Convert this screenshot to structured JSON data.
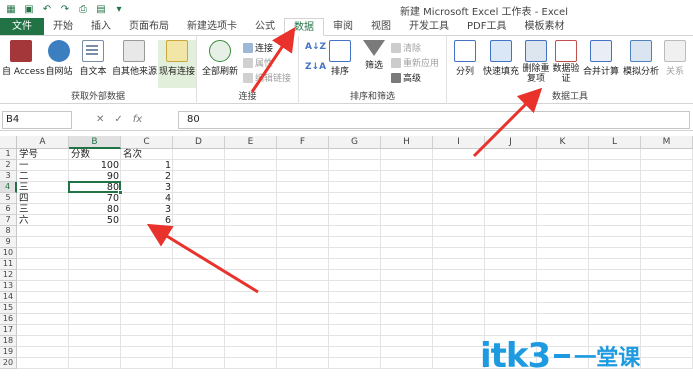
{
  "window": {
    "title": "新建 Microsoft Excel 工作表 - Excel"
  },
  "tabs": [
    "文件",
    "开始",
    "插入",
    "页面布局",
    "新建选项卡",
    "公式",
    "数据",
    "审阅",
    "视图",
    "开发工具",
    "PDF工具",
    "模板素材"
  ],
  "active_tab": "数据",
  "ribbon": {
    "get_external": {
      "label": "获取外部数据",
      "buttons": [
        "自 Access",
        "自网站",
        "自文本",
        "自其他来源",
        "现有连接"
      ]
    },
    "connections": {
      "label": "连接",
      "refresh_all": "全部刷新",
      "items": [
        "连接",
        "属性",
        "编辑链接"
      ]
    },
    "sort_filter": {
      "label": "排序和筛选",
      "sort": "排序",
      "filter": "筛选",
      "items": [
        "清除",
        "重新应用",
        "高级"
      ]
    },
    "data_tools": {
      "label": "数据工具",
      "buttons": [
        "分列",
        "快速填充",
        "删除重复项",
        "数据验证",
        "合并计算",
        "模拟分析",
        "关系"
      ]
    }
  },
  "formula_bar": {
    "name_box": "B4",
    "cancel": "✕",
    "enter": "✓",
    "fx": "fx",
    "value": "80"
  },
  "columns": [
    "A",
    "B",
    "C",
    "D",
    "E",
    "F",
    "G",
    "H",
    "I",
    "J",
    "K",
    "L",
    "M"
  ],
  "rows": [
    "1",
    "2",
    "3",
    "4",
    "5",
    "6",
    "7",
    "8",
    "9",
    "10",
    "11",
    "12",
    "13",
    "14",
    "15",
    "16",
    "17",
    "18",
    "19",
    "20"
  ],
  "active_cell": "B4",
  "sheet": {
    "headers": [
      "学号",
      "分数",
      "名次"
    ],
    "data": [
      [
        "一",
        "100",
        "1"
      ],
      [
        "二",
        "90",
        "2"
      ],
      [
        "三",
        "80",
        "3"
      ],
      [
        "四",
        "70",
        "4"
      ],
      [
        "三",
        "80",
        "3"
      ],
      [
        "六",
        "50",
        "6"
      ]
    ]
  },
  "watermark": {
    "main": "itk3",
    "sub": "一堂课"
  }
}
